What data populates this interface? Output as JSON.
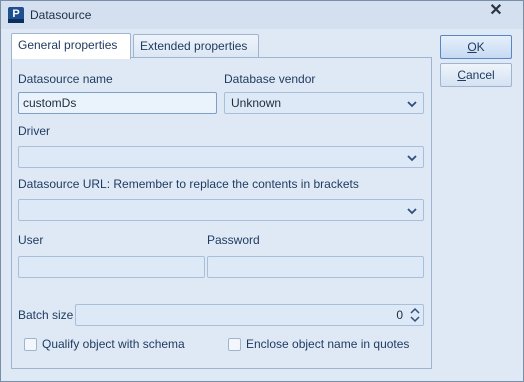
{
  "window": {
    "title": "Datasource",
    "app_icon_letter": "P"
  },
  "tabs": [
    {
      "label": "General properties",
      "active": true
    },
    {
      "label": "Extended properties",
      "active": false
    }
  ],
  "form": {
    "datasource_name_label": "Datasource name",
    "datasource_name_value": "customDs",
    "database_vendor_label": "Database vendor",
    "database_vendor_value": "Unknown",
    "driver_label": "Driver",
    "driver_value": "",
    "url_label": "Datasource URL: Remember to replace the contents in brackets",
    "url_value": "",
    "user_label": "User",
    "user_value": "",
    "password_label": "Password",
    "password_value": "",
    "batch_size_label": "Batch size",
    "batch_size_value": "0",
    "qualify_label": "Qualify object with schema",
    "qualify_checked": false,
    "enclose_label": "Enclose object name in quotes",
    "enclose_checked": false
  },
  "buttons": {
    "ok": {
      "mnemonic": "O",
      "rest": "K"
    },
    "cancel": {
      "mnemonic": "C",
      "rest": "ancel"
    }
  },
  "icons": {
    "close": "close-icon",
    "dropdown": "chevron-down-icon",
    "spinner": "spinner-icon"
  },
  "colors": {
    "background": "#dfe9f6",
    "accent": "#1f4f8f"
  }
}
